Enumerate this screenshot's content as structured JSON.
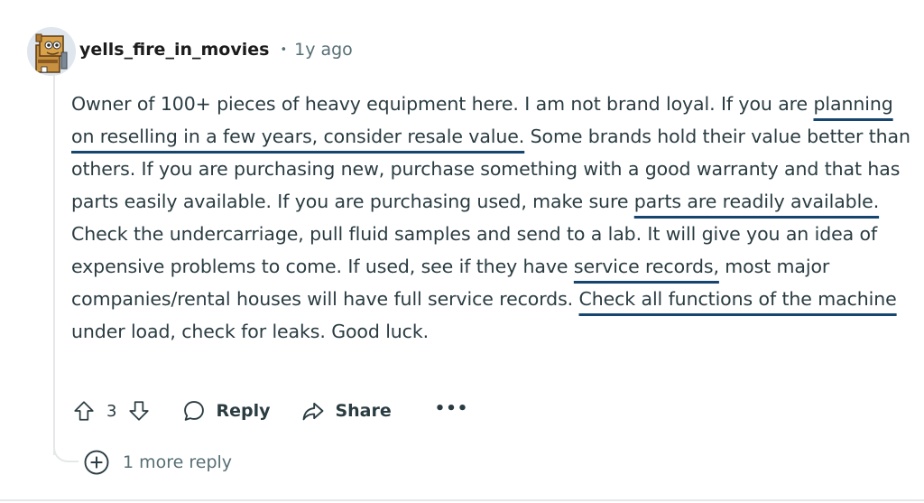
{
  "comment": {
    "author": "yells_fire_in_movies",
    "separator": "•",
    "age": "1y ago",
    "body": [
      {
        "text": "Owner of 100+ pieces of heavy equipment here. I am not brand loyal. If you are ",
        "underline": false
      },
      {
        "text": "planning on reselling in a few years, consider resale value.",
        "underline": true
      },
      {
        "text": " Some brands hold their value better than others. If you are purchasing new, purchase something with a good warranty and that has parts easily available. If you are purchasing used, make sure ",
        "underline": false
      },
      {
        "text": "parts are readily available.",
        "underline": true
      },
      {
        "text": " Check the undercarriage, pull fluid samples and send to a lab. It will give you an idea of expensive problems to come. If used, see if they have ",
        "underline": false
      },
      {
        "text": "service records,",
        "underline": true
      },
      {
        "text": " most major companies/rental houses will have full service records. ",
        "underline": false
      },
      {
        "text": "Check all functions of the machine",
        "underline": true
      },
      {
        "text": " under load, check for leaks. Good luck.",
        "underline": false
      }
    ]
  },
  "actions": {
    "upvote_icon": "arrow-up-outline-icon",
    "vote_count": "3",
    "downvote_icon": "arrow-down-outline-icon",
    "reply_icon": "speech-bubble-icon",
    "reply_label": "Reply",
    "share_icon": "share-arrow-icon",
    "share_label": "Share",
    "more_label": "•••"
  },
  "replies": {
    "expand_icon": "plus-circle-icon",
    "label": "1 more reply"
  },
  "colors": {
    "underline": "#16456f",
    "text": "#2a3c42",
    "meta": "#576f76",
    "thread": "#e5e7e9"
  }
}
